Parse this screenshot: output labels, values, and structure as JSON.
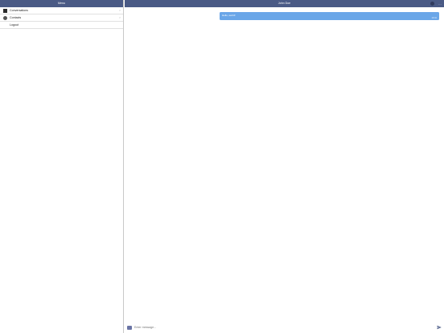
{
  "menu": {
    "title": "Menu",
    "items": [
      {
        "label": "Conversations",
        "icon": "conversations-icon",
        "chevron": ">"
      },
      {
        "label": "Contacts",
        "icon": "contacts-icon",
        "chevron": ">"
      },
      {
        "label": "Logout"
      }
    ]
  },
  "chat": {
    "contact_name": "John Doe",
    "more_label": "...",
    "messages": [
      {
        "text": "Hello, world!",
        "time": "10:41",
        "direction": "outgoing"
      }
    ],
    "composer": {
      "placeholder": "Enter message..."
    }
  },
  "colors": {
    "header_bg": "#4a5a85",
    "bubble_bg": "#6aa6e8",
    "send_icon": "#4a5a85"
  }
}
